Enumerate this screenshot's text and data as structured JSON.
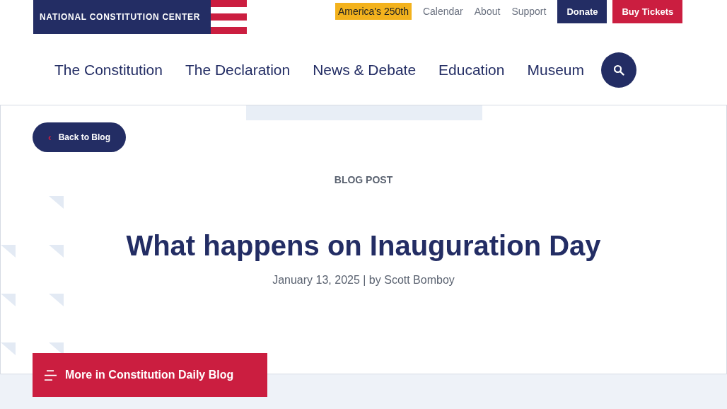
{
  "logo": {
    "text": "NATIONAL CONSTITUTION CENTER"
  },
  "utility_links": [
    {
      "label": "America's 250th",
      "kind": "highlight"
    },
    {
      "label": "Calendar",
      "kind": "link"
    },
    {
      "label": "About",
      "kind": "link"
    },
    {
      "label": "Support",
      "kind": "link"
    }
  ],
  "action_buttons": [
    {
      "label": "Donate",
      "kind": "navy"
    },
    {
      "label": "Buy Tickets",
      "kind": "red"
    }
  ],
  "main_nav": [
    "The Constitution",
    "The Declaration",
    "News & Debate",
    "Education",
    "Museum"
  ],
  "back_button": {
    "icon": "‹",
    "label": "Back to Blog"
  },
  "article": {
    "eyebrow": "BLOG POST",
    "title": "What happens on Inauguration Day",
    "byline": "January 13, 2025 | by Scott Bomboy"
  },
  "more_button": {
    "label": "More in Constitution Daily Blog"
  }
}
